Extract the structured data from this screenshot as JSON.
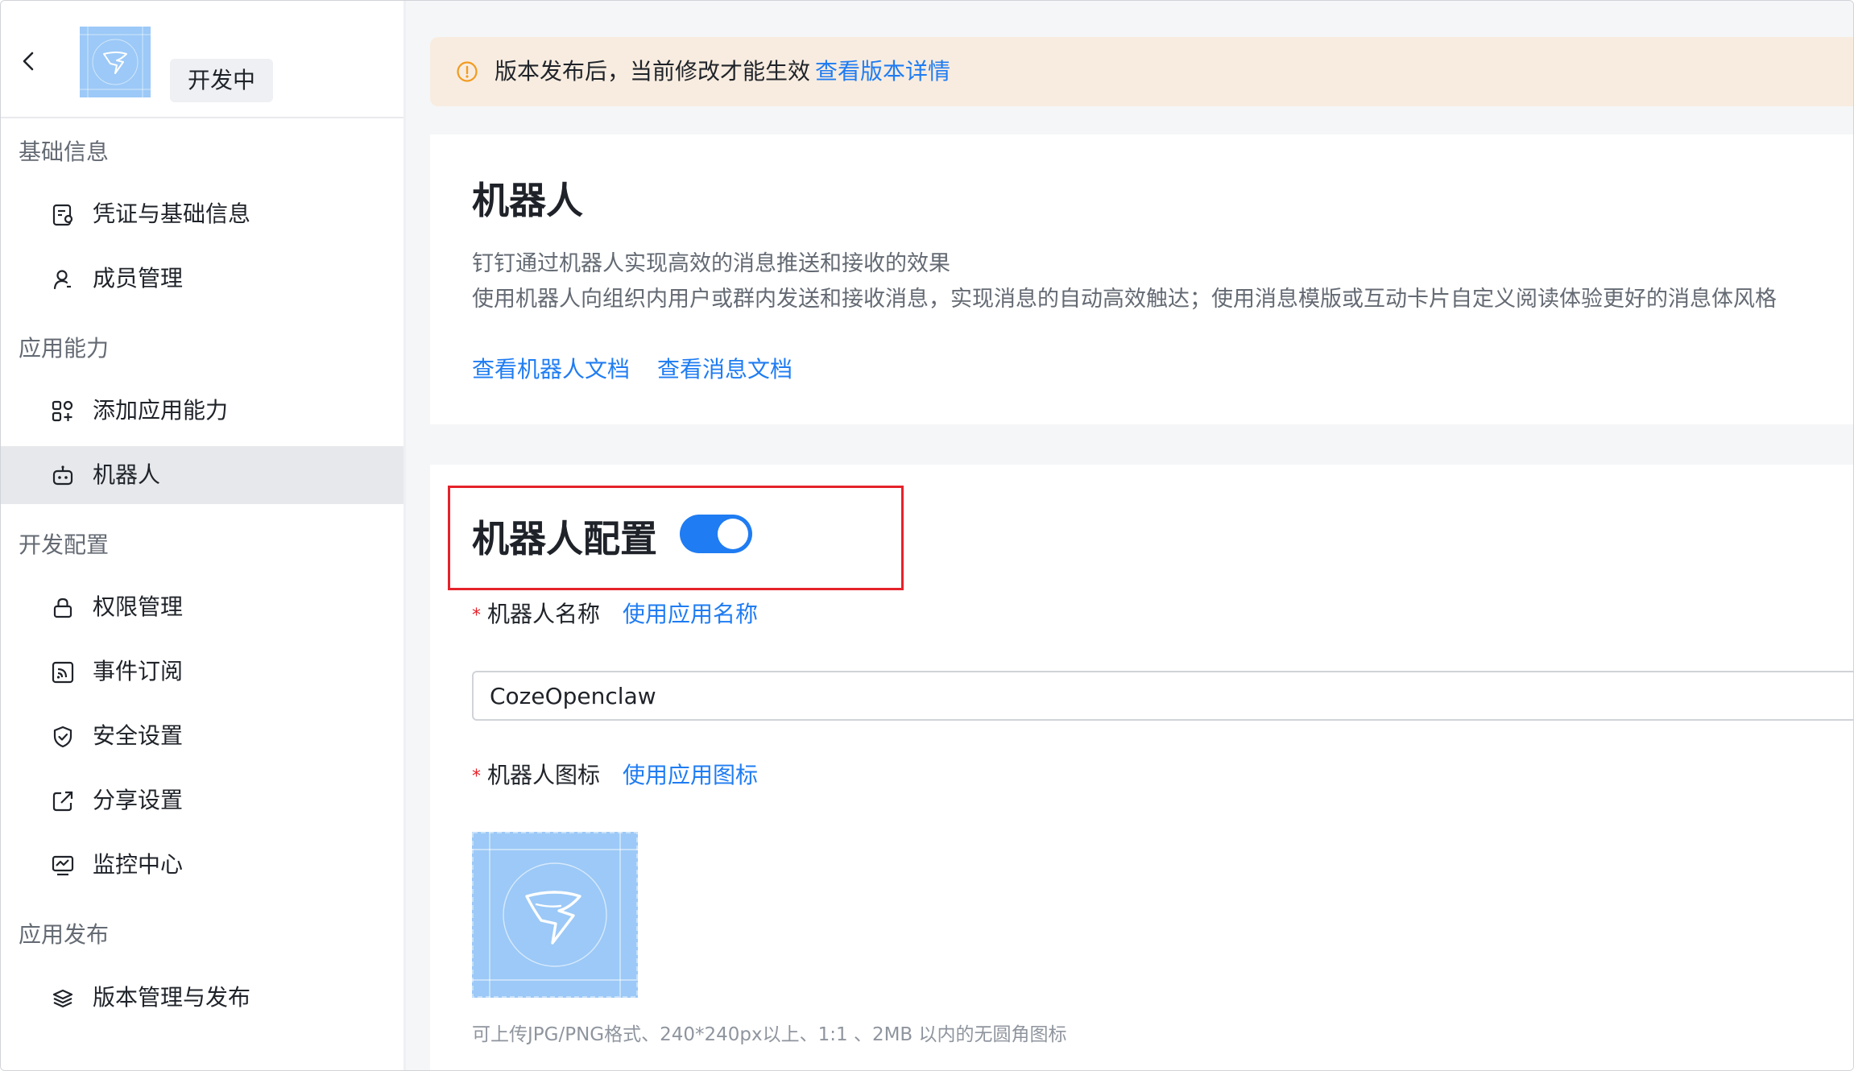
{
  "sidebar": {
    "badge": "开发中",
    "groups": [
      {
        "label": "基础信息",
        "items": [
          {
            "label": "凭证与基础信息",
            "icon": "credential-icon"
          },
          {
            "label": "成员管理",
            "icon": "user-icon"
          }
        ]
      },
      {
        "label": "应用能力",
        "items": [
          {
            "label": "添加应用能力",
            "icon": "add-capability-icon"
          },
          {
            "label": "机器人",
            "icon": "robot-icon",
            "active": true
          }
        ]
      },
      {
        "label": "开发配置",
        "items": [
          {
            "label": "权限管理",
            "icon": "lock-icon"
          },
          {
            "label": "事件订阅",
            "icon": "rss-icon"
          },
          {
            "label": "安全设置",
            "icon": "shield-icon"
          },
          {
            "label": "分享设置",
            "icon": "share-icon"
          },
          {
            "label": "监控中心",
            "icon": "monitor-icon"
          }
        ]
      },
      {
        "label": "应用发布",
        "items": [
          {
            "label": "版本管理与发布",
            "icon": "layers-icon"
          }
        ]
      }
    ]
  },
  "notice": {
    "text": "版本发布后，当前修改才能生效",
    "link": "查看版本详情"
  },
  "robot_card": {
    "title": "机器人",
    "desc1": "钉钉通过机器人实现高效的消息推送和接收的效果",
    "desc2": "使用机器人向组织内用户或群内发送和接收消息，实现消息的自动高效触达；使用消息模版或互动卡片自定义阅读体验更好的消息体风格",
    "links": [
      "查看机器人文档",
      "查看消息文档"
    ]
  },
  "config_card": {
    "title": "机器人配置",
    "toggle_on": true,
    "name_label": "机器人名称",
    "name_link": "使用应用名称",
    "name_value": "CozeOpenclaw",
    "icon_label": "机器人图标",
    "icon_link": "使用应用图标",
    "upload_hint": "可上传JPG/PNG格式、240*240px以上、1:1 、2MB 以内的无圆角图标",
    "required_mark": "*"
  },
  "colors": {
    "accent": "#1f7cf2",
    "highlight": "#e5222b",
    "notice_bg": "#f8ece0",
    "icon_bg": "#9cc9f7"
  }
}
